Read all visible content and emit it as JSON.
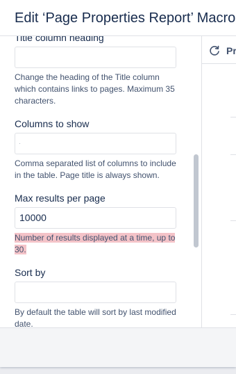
{
  "dialog": {
    "title": "Edit ‘Page Properties Report’ Macro"
  },
  "form": {
    "title_heading": {
      "label": "Title column heading",
      "value": "",
      "description": "Change the heading of the Title column which contains links to pages. Maximum 35 characters."
    },
    "columns_to_show": {
      "label": "Columns to show",
      "value": "",
      "description": "Comma separated list of columns to include in the table. Page title is always shown."
    },
    "max_results": {
      "label": "Max results per page",
      "value": "10000",
      "description": "Number of results displayed at a time, up to 30.",
      "description_highlight_color": "#f4c3c8"
    },
    "sort_by": {
      "label": "Sort by",
      "value": "",
      "description": "By default the table will sort by last modified date."
    }
  },
  "preview": {
    "refresh_icon": "refresh-icon",
    "label": "Pr"
  },
  "colors": {
    "border": "#dfe1e6",
    "text": "#172b4d",
    "muted_text": "#42526e",
    "scrollbar": "#c1c7d0"
  }
}
